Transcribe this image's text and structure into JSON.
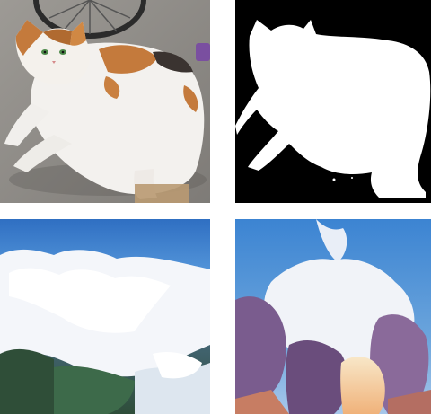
{
  "images": [
    {
      "subject": "calico-cat-photo"
    },
    {
      "subject": "cat-segmentation-mask"
    },
    {
      "subject": "aerial-cloud-landscape"
    },
    {
      "subject": "sunset-cumulus-clouds"
    }
  ],
  "colors": {
    "background": "#ffffff",
    "mask_fg": "#ffffff",
    "mask_bg": "#000000",
    "sky_blue": "#3f86d4",
    "cloud": "#f4f6fa",
    "sunset_purple": "#7a5c8e",
    "floor": "#8f8c88"
  }
}
